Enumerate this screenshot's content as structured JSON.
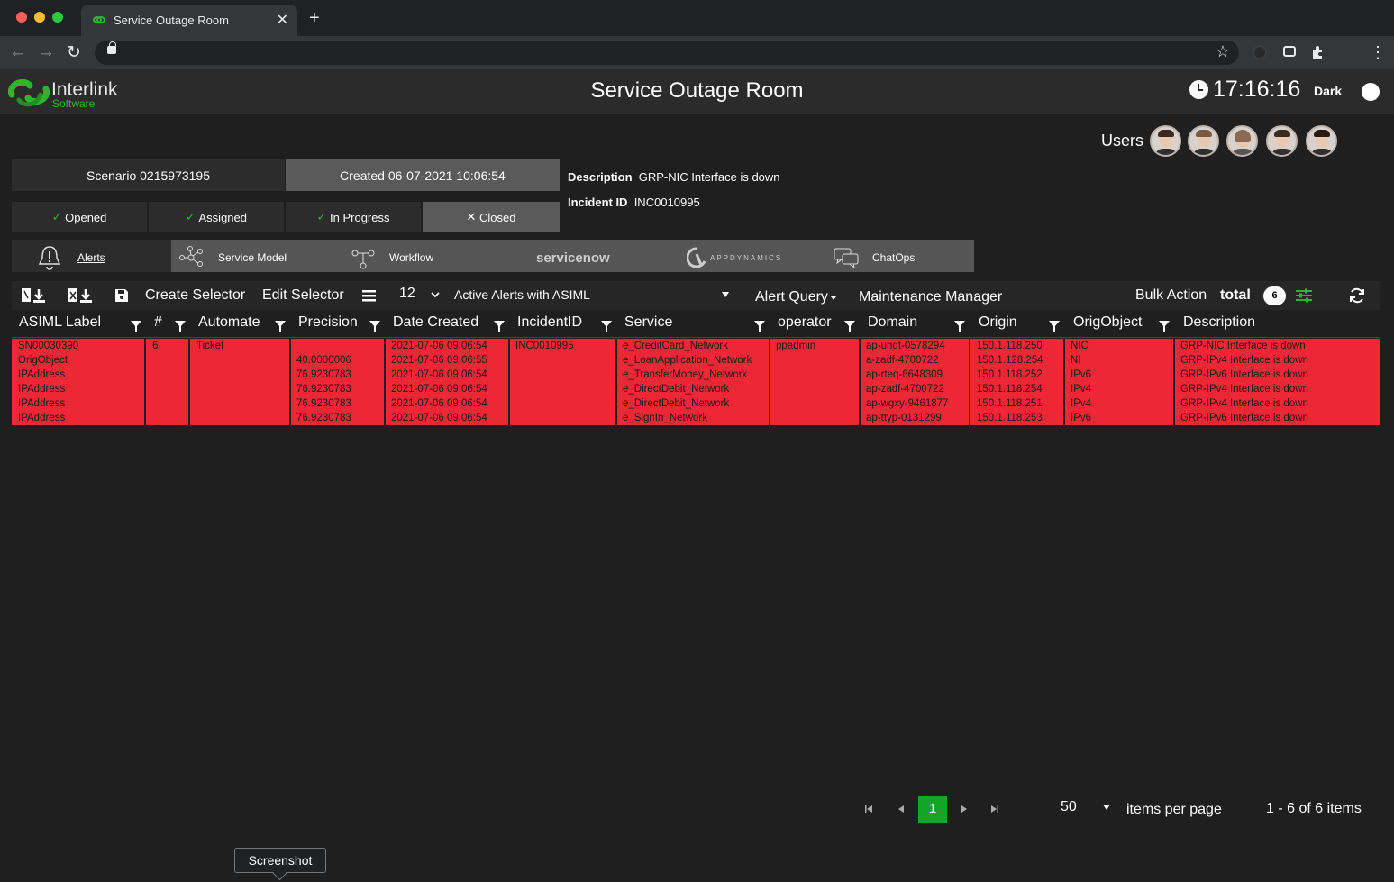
{
  "browser": {
    "tab_title": "Service Outage Room",
    "tab_close": "✕",
    "new_tab": "+",
    "back": "←",
    "forward": "→",
    "reload": "↻",
    "bookmark": "☆",
    "menu": "⋮"
  },
  "header": {
    "logo_name": "Interlink",
    "logo_sub": "Software",
    "title": "Service Outage Room",
    "clock": "17:16:16",
    "theme_label": "Dark"
  },
  "scenario": {
    "scenario_label": "Scenario",
    "scenario_id": "0215973195",
    "created_label": "Created",
    "created_value": "06-07-2021 10:06:54",
    "description_label": "Description",
    "description_value": "GRP-NIC Interface is down",
    "incident_label": "Incident ID",
    "incident_value": "INC0010995"
  },
  "states": [
    {
      "icon": "✓",
      "label": "Opened"
    },
    {
      "icon": "✓",
      "label": "Assigned"
    },
    {
      "icon": "✓",
      "label": "In Progress"
    },
    {
      "icon": "✕",
      "label": "Closed"
    }
  ],
  "nav_tabs": {
    "alerts": "Alerts",
    "service_model": "Service Model",
    "workflow": "Workflow",
    "servicenow": "servicenow",
    "appdynamics": "APPDYNAMICS",
    "chatops": "ChatOps"
  },
  "users_label": "Users",
  "actions": {
    "create_selector": "Create Selector",
    "edit_selector": "Edit Selector",
    "count": "12",
    "selector_name": "Active Alerts with ASIML",
    "alert_query": "Alert Query",
    "maintenance_manager": "Maintenance Manager",
    "bulk_action": "Bulk Action",
    "total_label": "total",
    "total_count": "6"
  },
  "columns": [
    "ASIML Label",
    "#",
    "Automate",
    "Precision",
    "Date Created",
    "IncidentID",
    "Service",
    "operator",
    "Domain",
    "Origin",
    "OrigObject",
    "Description"
  ],
  "row": {
    "asiml_label": [
      "SN00030390",
      "OrigObject",
      "IPAddress",
      "IPAddress",
      "IPAddress",
      "IPAddress"
    ],
    "count": "6",
    "automate": "Ticket",
    "precision": [
      "",
      "40.0000006",
      "76.9230783",
      "76.9230783",
      "76.9230783",
      "76.9230783"
    ],
    "date_created": [
      "2021-07-06 09:06:54",
      "2021-07-06 09:06:55",
      "2021-07-06 09:06:54",
      "2021-07-06 09:06:54",
      "2021-07-06 09:06:54",
      "2021-07-06 09:06:54"
    ],
    "incident_id": "INC0010995",
    "service": [
      "e_CreditCard_Network",
      "e_LoanApplication_Network",
      "e_TransferMoney_Network",
      "e_DirectDebit_Network",
      "e_DirectDebit_Network",
      "e_SignIn_Network"
    ],
    "operator": "ppadmin",
    "domain": [
      "ap-uhdt-0578294",
      "a-zadf-4700722",
      "ap-rteq-6648309",
      "ap-zadf-4700722",
      "ap-wgxy-9461877",
      "ap-ttyp-0131299"
    ],
    "origin": [
      "150.1.118.250",
      "150.1.128.254",
      "150.1.118.252",
      "150.1.118.254",
      "150.1.118.251",
      "150.1.118.253"
    ],
    "orig_object": [
      "NIC",
      "NI",
      "IPv6",
      "IPv4",
      "IPv4",
      "IPv6"
    ],
    "description": [
      "GRP-NIC Interface is down",
      "GRP-IPv4 Interface is down",
      "GRP-IPv6 Interface is down",
      "GRP-IPv4 Interface is down",
      "GRP-IPv4 Interface is down",
      "GRP-IPv6 Interface is down"
    ]
  },
  "pager": {
    "current_page": "1",
    "per_page": "50",
    "per_page_label": "items per page",
    "summary": "1 - 6 of 6 items"
  },
  "tooltip": "Screenshot",
  "colors": {
    "alert_row": "#ee2737",
    "accent_green": "#16a32a",
    "brand_green": "#2db52d"
  }
}
